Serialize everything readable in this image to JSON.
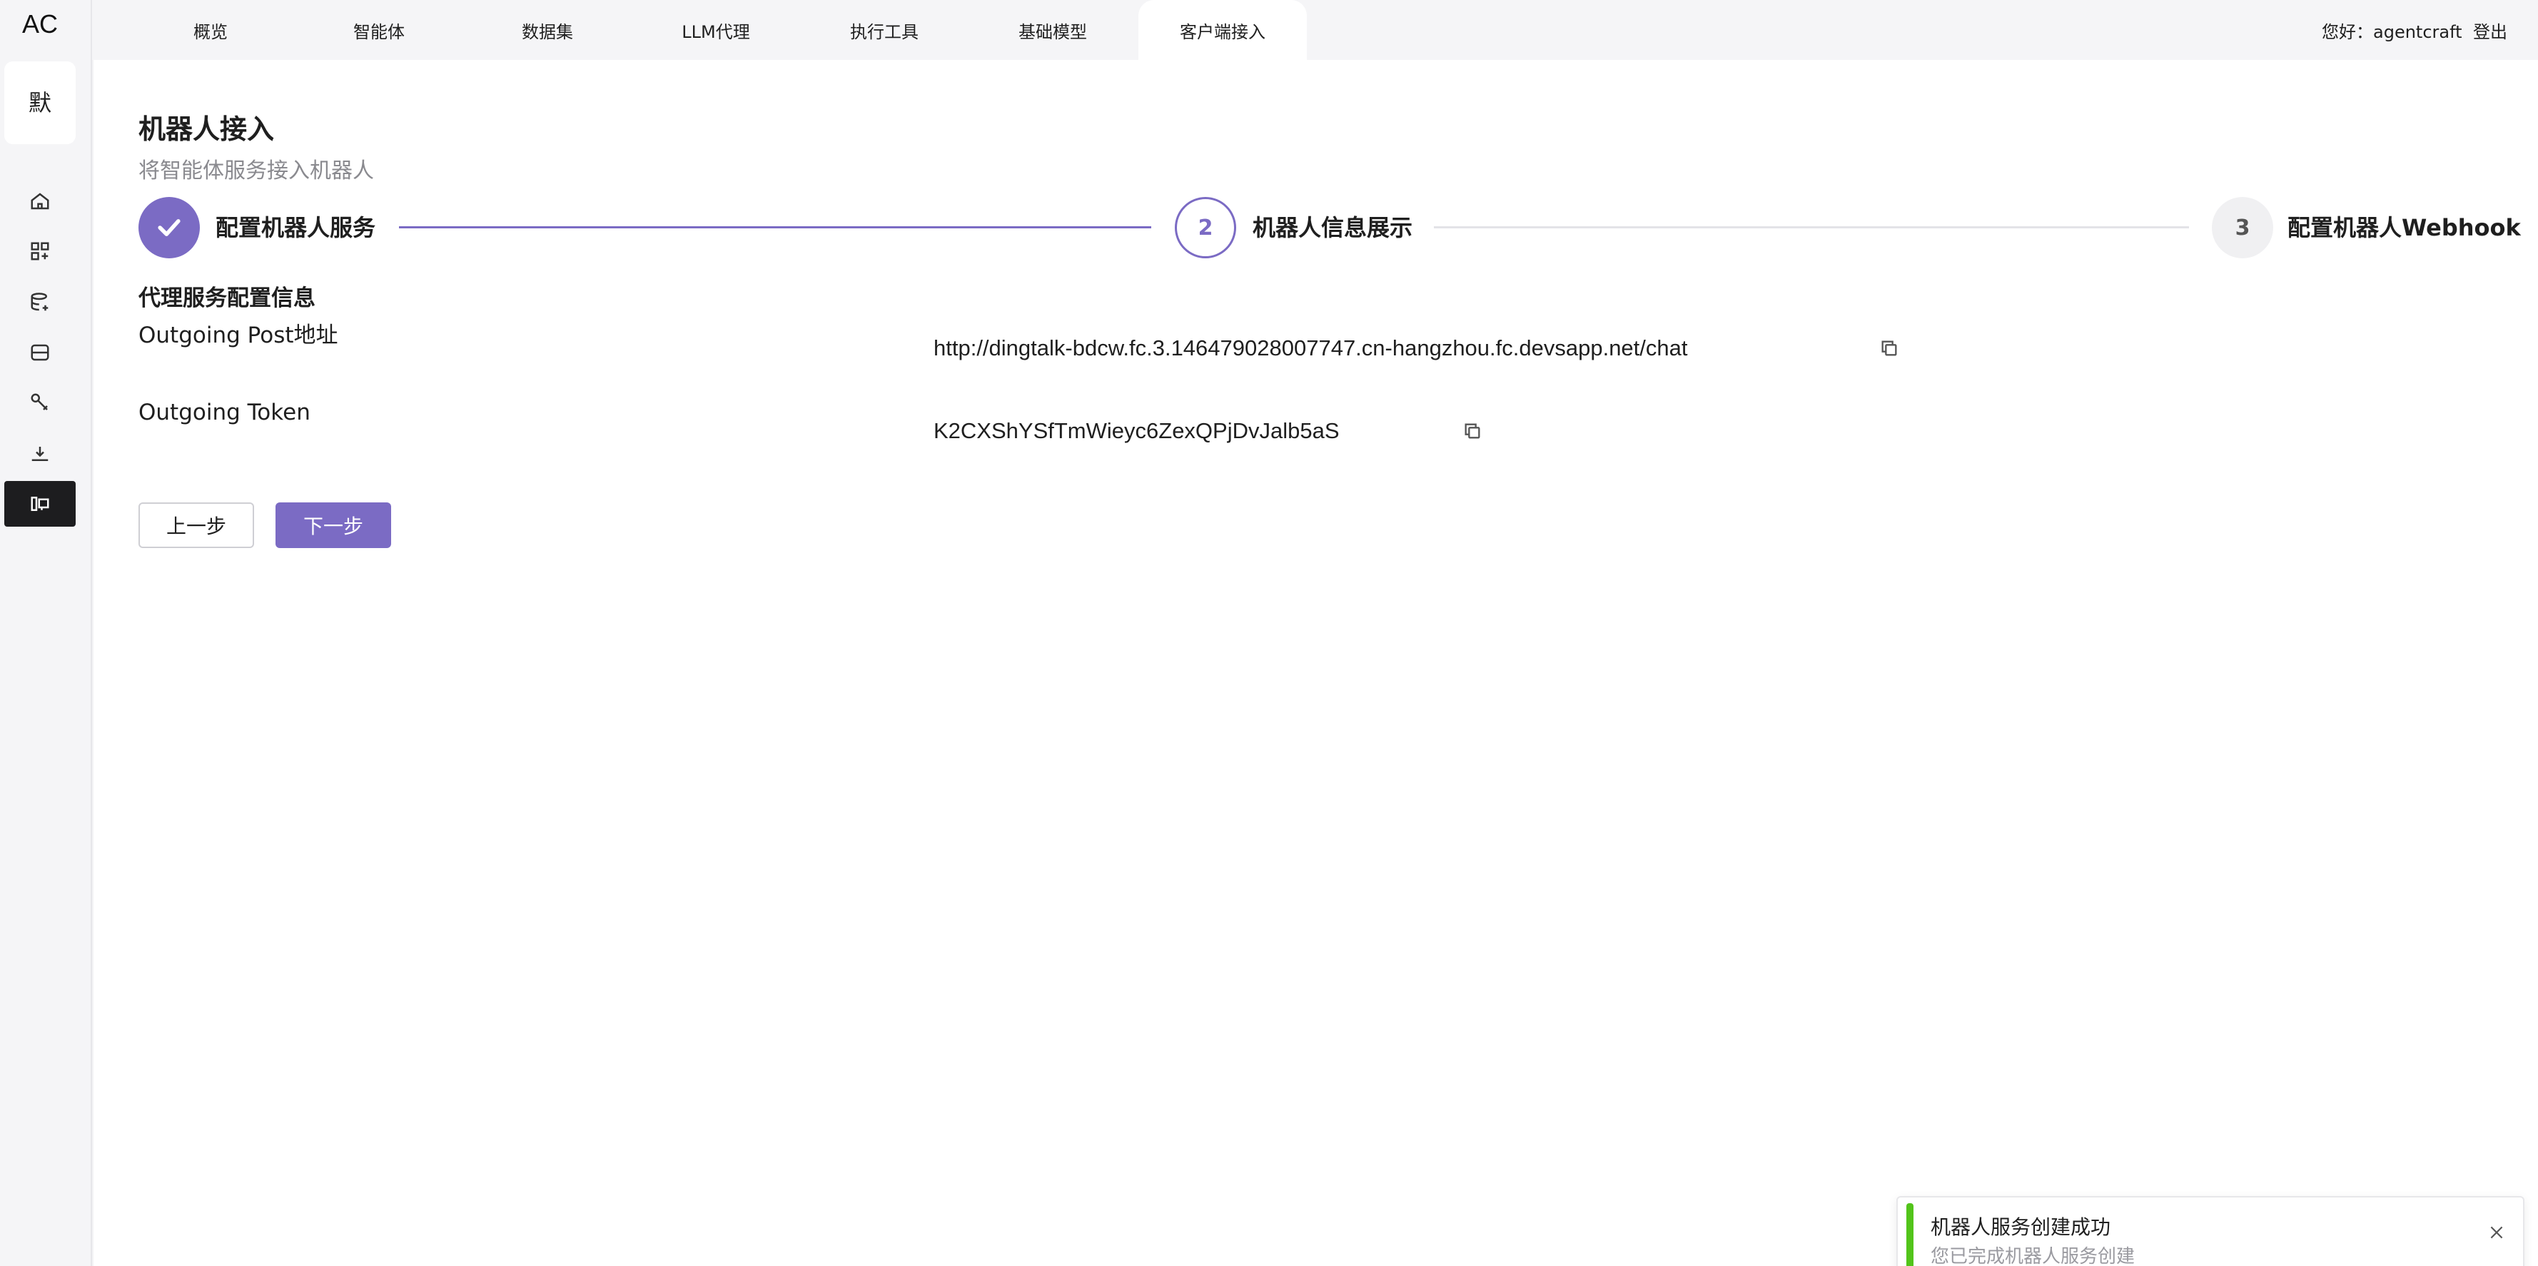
{
  "app": {
    "logo": "AC",
    "workspace_initial": "默"
  },
  "sidebar": {
    "icons": [
      "home-icon",
      "apps-icon",
      "dataset-icon",
      "storage-icon",
      "tool-icon",
      "model-icon",
      "client-access-icon"
    ]
  },
  "topnav": {
    "tabs": [
      {
        "label": "概览"
      },
      {
        "label": "智能体"
      },
      {
        "label": "数据集"
      },
      {
        "label": "LLM代理"
      },
      {
        "label": "执行工具"
      },
      {
        "label": "基础模型"
      },
      {
        "label": "客户端接入"
      }
    ],
    "greeting": "您好：agentcraft",
    "logout": "登出"
  },
  "page": {
    "title": "机器人接入",
    "subtitle": "将智能体服务接入机器人"
  },
  "steps": [
    {
      "number": "1",
      "label": "配置机器人服务",
      "status": "done"
    },
    {
      "number": "2",
      "label": "机器人信息展示",
      "status": "current"
    },
    {
      "number": "3",
      "label": "配置机器人Webhook",
      "status": "pending"
    }
  ],
  "section": {
    "title": "代理服务配置信息",
    "fields": [
      {
        "label": "Outgoing Post地址",
        "value": "http://dingtalk-bdcw.fc.3.146479028007747.cn-hangzhou.fc.devsapp.net/chat"
      },
      {
        "label": "Outgoing Token",
        "value": "K2CXShYSfTmWieyc6ZexQPjDvJalb5aS"
      }
    ]
  },
  "buttons": {
    "prev": "上一步",
    "next": "下一步"
  },
  "toast": {
    "title": "机器人服务创建成功",
    "desc": "您已完成机器人服务创建"
  },
  "colors": {
    "accent": "#7b6bc4",
    "success": "#52c41a",
    "sidebar_active": "#1d1d1f"
  }
}
